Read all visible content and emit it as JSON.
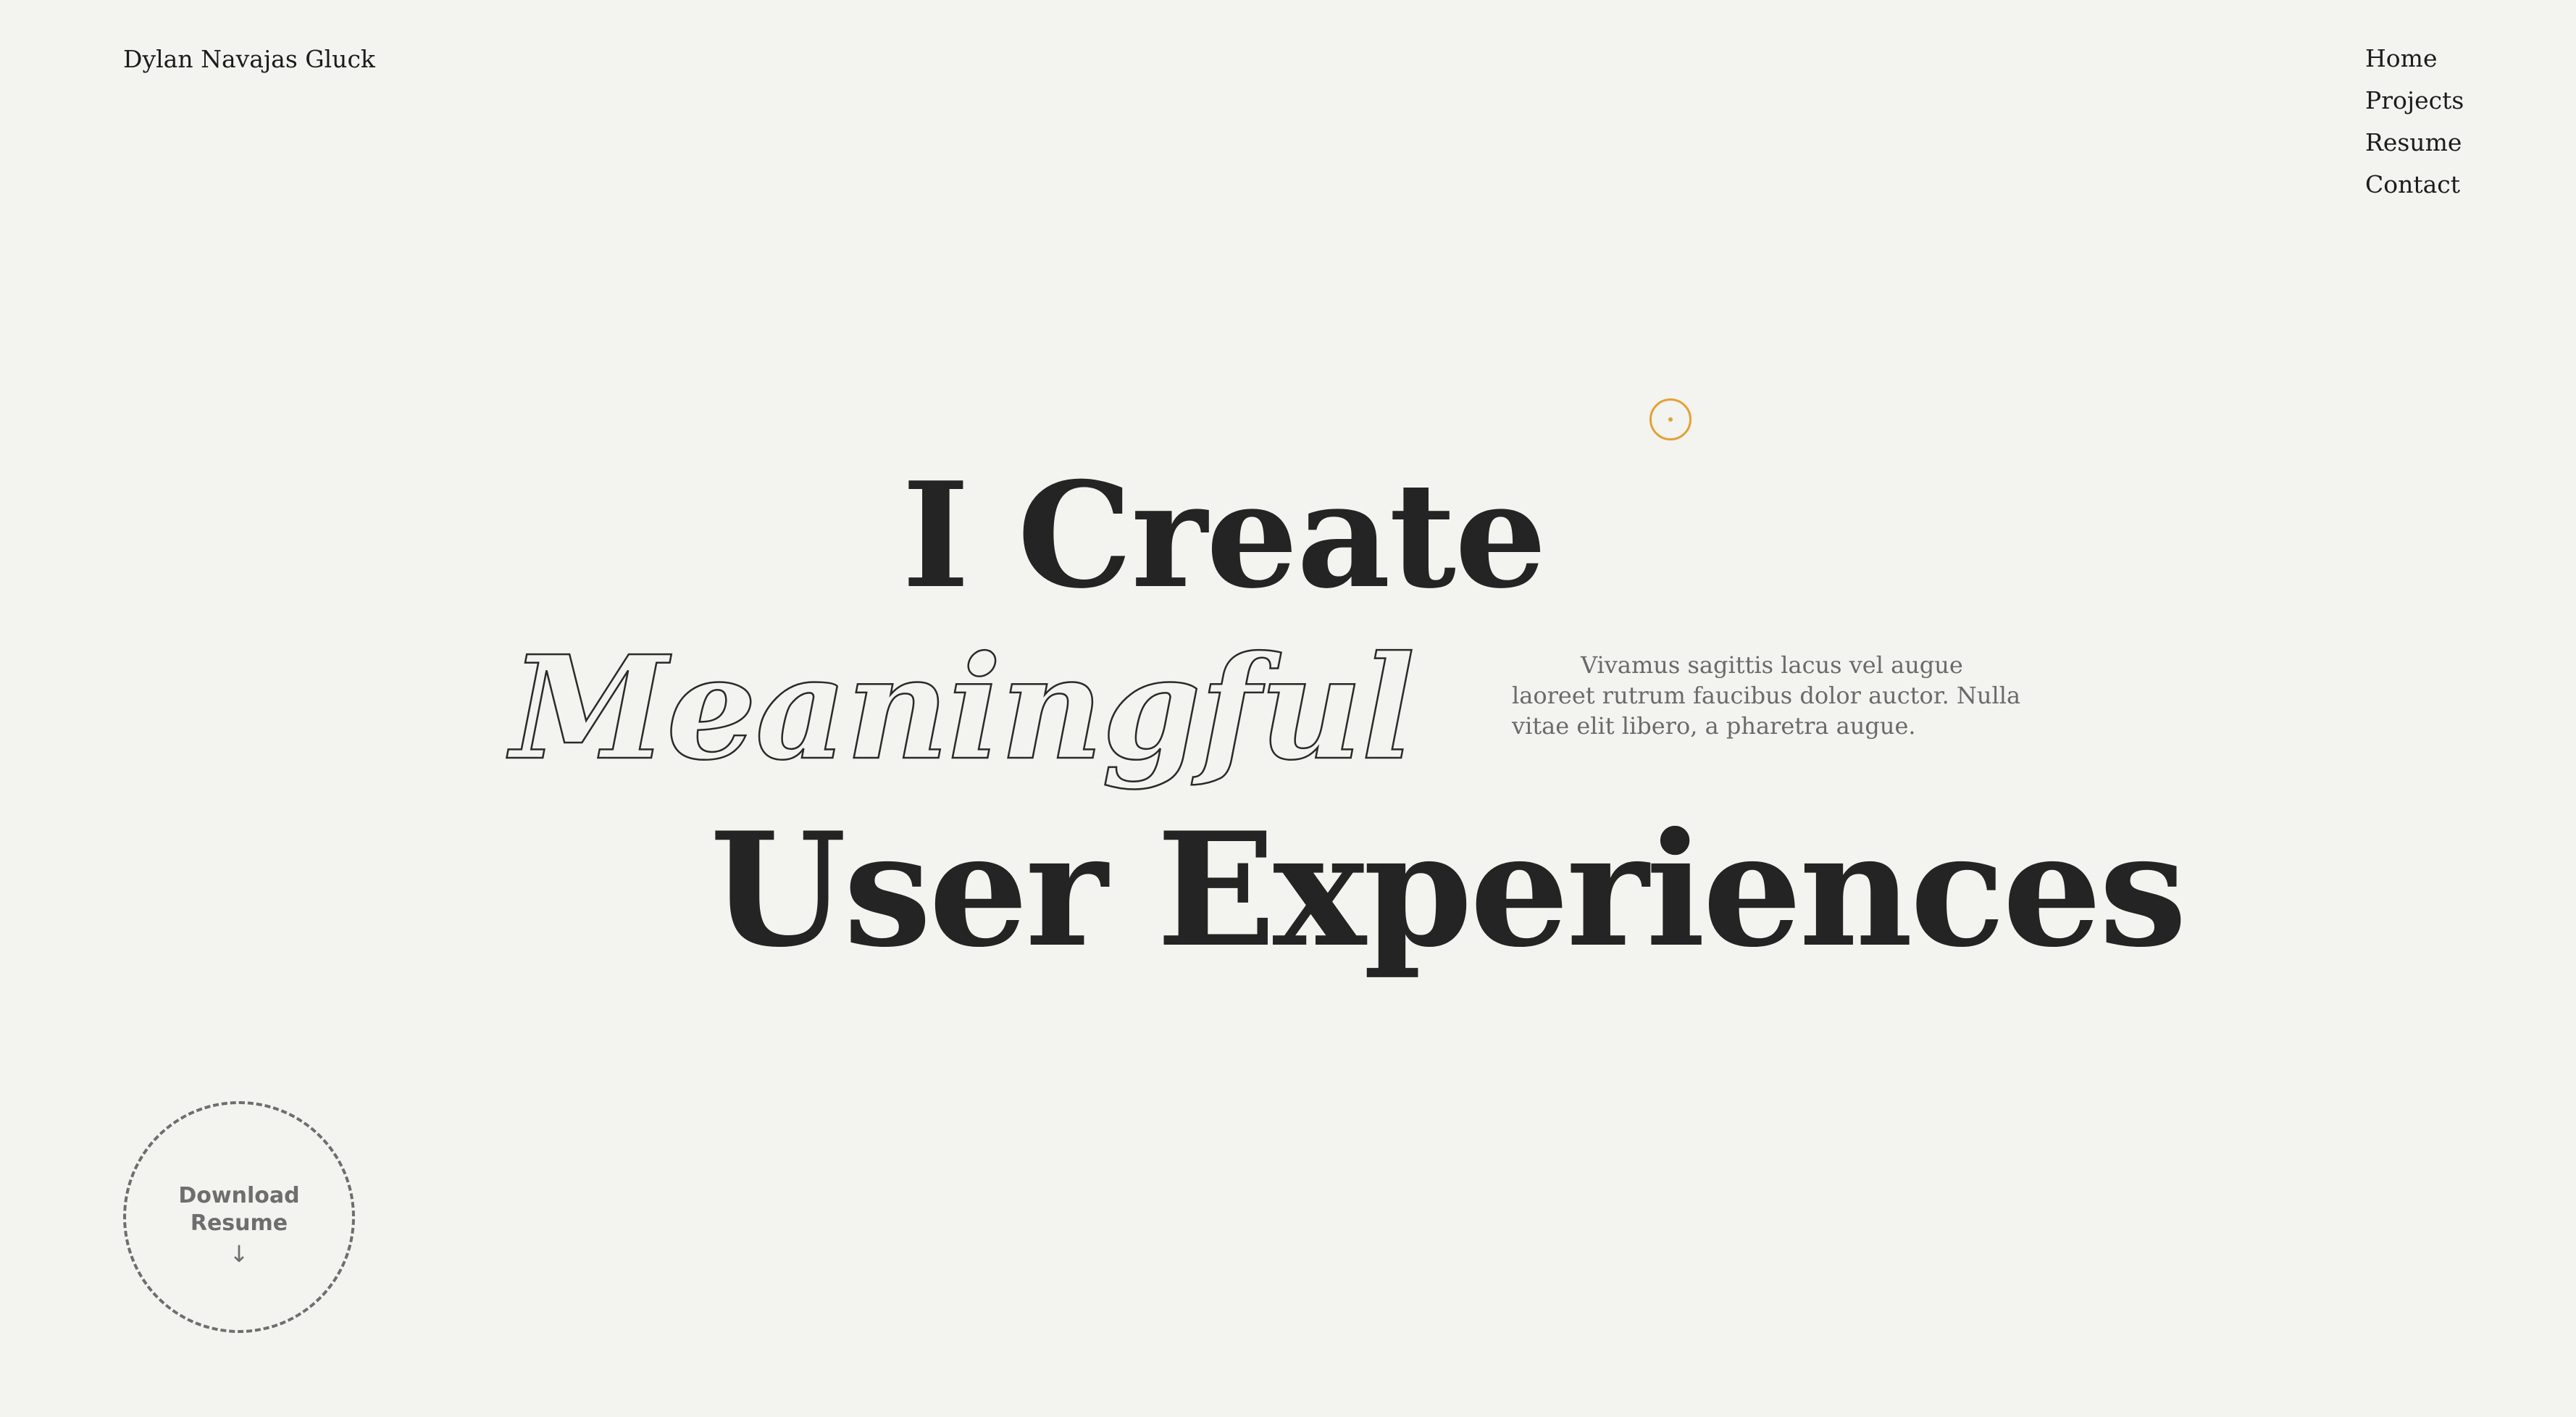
{
  "header": {
    "site_name": "Dylan Navajas Gluck"
  },
  "nav": {
    "items": [
      "Home",
      "Projects",
      "Resume",
      "Contact"
    ]
  },
  "hero": {
    "line1": "I Create",
    "line2": "Meaningful",
    "line3": "User Experiences",
    "tagline": "Vivamus sagittis lacus vel augue laoreet rutrum faucibus dolor auctor. Nulla vitae elit libero, a pharetra augue."
  },
  "download": {
    "label": "Download Resume",
    "icon": "arrow-down-icon"
  },
  "colors": {
    "background": "#f3f3ef",
    "text": "#242424",
    "accent": "#e4a036",
    "muted": "#6e6e6e"
  }
}
